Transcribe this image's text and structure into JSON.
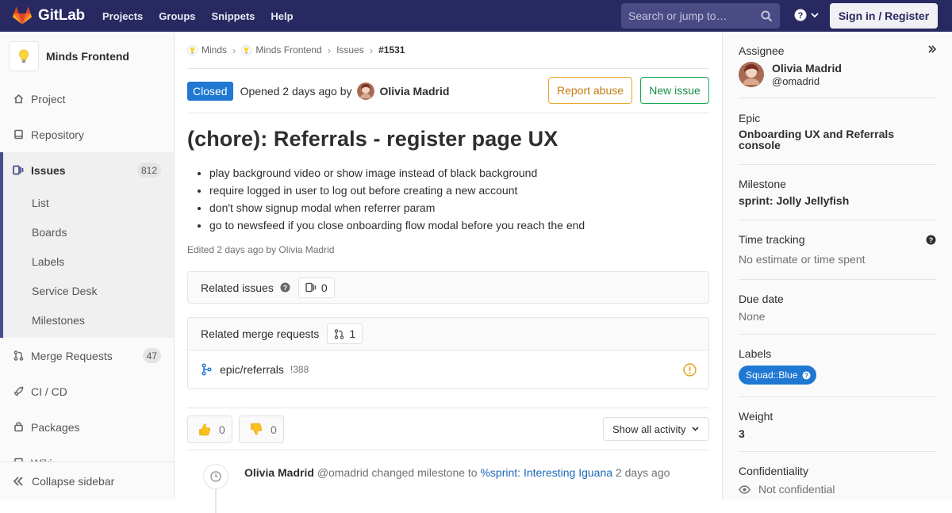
{
  "topbar": {
    "brand": "GitLab",
    "nav": [
      "Projects",
      "Groups",
      "Snippets",
      "Help"
    ],
    "search_placeholder": "Search or jump to…",
    "signin_label": "Sign in / Register",
    "bg_color": "#292961"
  },
  "sidebar": {
    "project_name": "Minds Frontend",
    "items": [
      {
        "label": "Project",
        "icon": "home-icon"
      },
      {
        "label": "Repository",
        "icon": "book-icon"
      },
      {
        "label": "Issues",
        "icon": "issues-icon",
        "count": "812",
        "active": true
      },
      {
        "label": "Merge Requests",
        "icon": "merge-request-icon",
        "count": "47"
      },
      {
        "label": "CI / CD",
        "icon": "rocket-icon"
      },
      {
        "label": "Packages",
        "icon": "package-icon"
      },
      {
        "label": "Wiki",
        "icon": "book-icon"
      }
    ],
    "issues_subitems": [
      "List",
      "Boards",
      "Labels",
      "Service Desk",
      "Milestones"
    ],
    "collapse_label": "Collapse sidebar"
  },
  "breadcrumb": [
    "Minds",
    "Minds Frontend",
    "Issues",
    "#1531"
  ],
  "issue": {
    "status": "Closed",
    "opened_text": "Opened 2 days ago by",
    "author": "Olivia Madrid",
    "report_abuse_label": "Report abuse",
    "new_issue_label": "New issue",
    "title": "(chore): Referrals - register page UX",
    "description_items": [
      "play background video or show image instead of black background",
      "require logged in user to log out before creating a new account",
      "don't show signup modal when referrer param",
      "go to newsfeed if you close onboarding flow modal before you reach the end"
    ],
    "edited_text": "Edited 2 days ago by Olivia Madrid",
    "related_issues_label": "Related issues",
    "related_issues_count": "0",
    "related_mr_label": "Related merge requests",
    "related_mr_count": "1",
    "merge_request": {
      "branch": "epic/referrals",
      "id": "!388"
    },
    "thumbs_up_count": "0",
    "thumbs_down_count": "0",
    "show_activity_label": "Show all activity",
    "note": {
      "author": "Olivia Madrid",
      "handle": "@omadrid",
      "action": "changed milestone to",
      "milestone_link": "%sprint: Interesting Iguana",
      "time": "2 days ago"
    }
  },
  "right_sidebar": {
    "assignee_label": "Assignee",
    "assignee_name": "Olivia Madrid",
    "assignee_handle": "@omadrid",
    "epic_label": "Epic",
    "epic_value": "Onboarding UX and Referrals console",
    "milestone_label": "Milestone",
    "milestone_value": "sprint: Jolly Jellyfish",
    "time_tracking_label": "Time tracking",
    "time_tracking_value": "No estimate or time spent",
    "due_date_label": "Due date",
    "due_date_value": "None",
    "labels_label": "Labels",
    "label_chip": "Squad::Blue",
    "label_color": "#1f78d1",
    "weight_label": "Weight",
    "weight_value": "3",
    "confidentiality_label": "Confidentiality",
    "confidentiality_value": "Not confidential"
  }
}
